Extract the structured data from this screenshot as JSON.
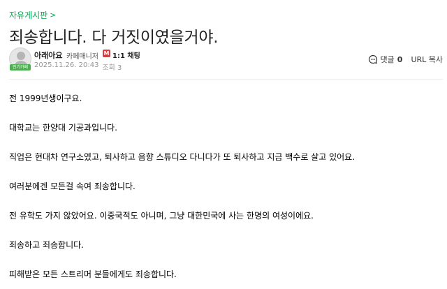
{
  "board": {
    "name": "자유게시판",
    "chevron": ">"
  },
  "post": {
    "title": "죄송합니다. 다 거짓이였을거야.",
    "author": {
      "name": "아래아요",
      "role": "카페매니저",
      "badge_label": "인기카페",
      "role_icon": "M",
      "chat_label": "1:1 채팅"
    },
    "date": "2025.11.26. 20:43",
    "views_label": "조회 3",
    "actions": {
      "comment_label": "댓글",
      "comment_count": "0",
      "url_copy_label": "URL 복사"
    },
    "paragraphs": [
      "전 1999년생이구요.",
      "대학교는 한양대 기공과입니다.",
      "직업은 현대차 연구소였고, 퇴사하고 음향 스튜디오 다니다가 또 퇴사하고 지금 백수로 살고 있어요.",
      "여러분에겐 모든걸 속여 죄송합니다.",
      "전 유학도 가지 않았어요. 이중국적도 아니며, 그냥 대한민국에 사는 한명의 여성이에요.",
      "죄송하고 죄송합니다.",
      "피해받은 모든 스트리머 분들에게도 죄송합니다."
    ]
  },
  "colors": {
    "board_link": "#03a94d",
    "role_icon": "#e0383b",
    "badge": "#4caf50"
  }
}
